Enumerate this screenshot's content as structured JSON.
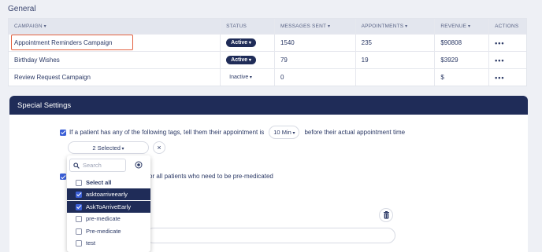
{
  "section_title": "General",
  "table": {
    "headers": [
      "CAMPAIGN",
      "STATUS",
      "MESSAGES SENT",
      "APPOINTMENTS",
      "REVENUE",
      "ACTIONS"
    ],
    "rows": [
      {
        "campaign": "Appointment Reminders Campaign",
        "status": "Active",
        "messages": "1540",
        "appointments": "235",
        "revenue": "$90808",
        "actions": "•••"
      },
      {
        "campaign": "Birthday Wishes",
        "status": "Active",
        "messages": "79",
        "appointments": "19",
        "revenue": "$3929",
        "actions": "•••"
      },
      {
        "campaign": "Review Request Campaign",
        "status": "Inactive",
        "messages": "0",
        "appointments": "",
        "revenue": "$",
        "actions": "•••"
      }
    ]
  },
  "special": {
    "title": "Special Settings",
    "line1_before": "If a patient has any of the following tags, tell them their appointment is",
    "minutes": "10 Min",
    "line1_after": "before their actual appointment time",
    "selected": "2 Selected",
    "close": "×",
    "line2_tail": "or all patients who need to be pre-medicated"
  },
  "dropdown": {
    "search_placeholder": "Search",
    "items": [
      {
        "label": "Select all",
        "checked": false,
        "bold": true
      },
      {
        "label": "asktoarriveearly",
        "checked": true,
        "bold": false
      },
      {
        "label": "AskToArriveEarly",
        "checked": true,
        "bold": false
      },
      {
        "label": "pre-medicate",
        "checked": false,
        "bold": false
      },
      {
        "label": "Pre-medicate",
        "checked": false,
        "bold": false
      },
      {
        "label": "test",
        "checked": false,
        "bold": false
      }
    ]
  },
  "colors": {
    "navy": "#1f2c58",
    "accent": "#3b5fd6",
    "highlight": "#e2603f"
  }
}
